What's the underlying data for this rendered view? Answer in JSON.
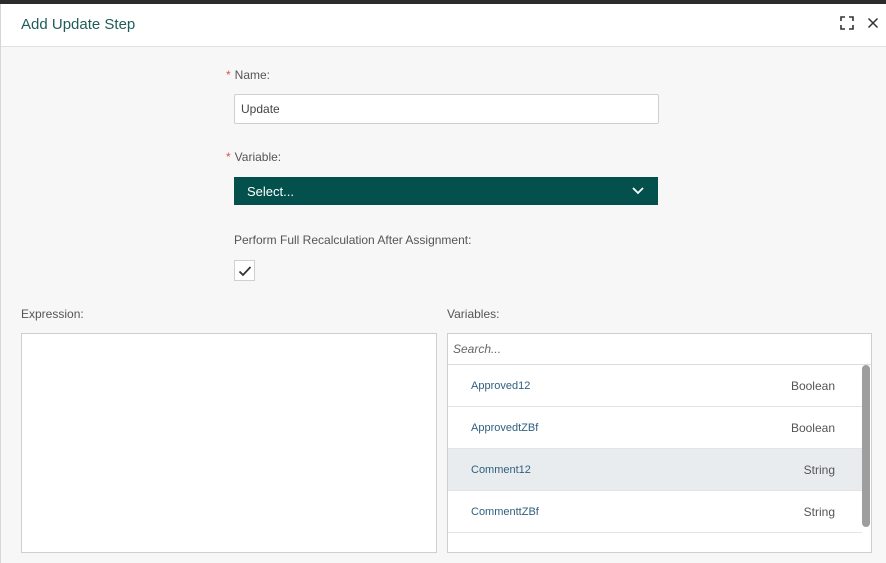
{
  "dialog": {
    "title": "Add Update Step",
    "maximize_icon": "maximize-icon",
    "close_icon": "close-icon"
  },
  "form": {
    "name_label": "Name:",
    "name_value": "Update",
    "variable_label": "Variable:",
    "variable_select_value": "Select...",
    "recalc_label": "Perform Full Recalculation After Assignment:",
    "recalc_checked": true,
    "required_marker": "*"
  },
  "expression": {
    "label": "Expression:"
  },
  "variables": {
    "label": "Variables:",
    "search_placeholder": "Search...",
    "items": [
      {
        "name": "Approved12",
        "type": "Boolean"
      },
      {
        "name": "ApprovedtZBf",
        "type": "Boolean"
      },
      {
        "name": "Comment12",
        "type": "String"
      },
      {
        "name": "CommenttZBf",
        "type": "String"
      }
    ]
  },
  "colors": {
    "accent": "#03504d",
    "title": "#1f5c5a",
    "required": "#d9534f",
    "row_highlight": "#e9ecee"
  }
}
